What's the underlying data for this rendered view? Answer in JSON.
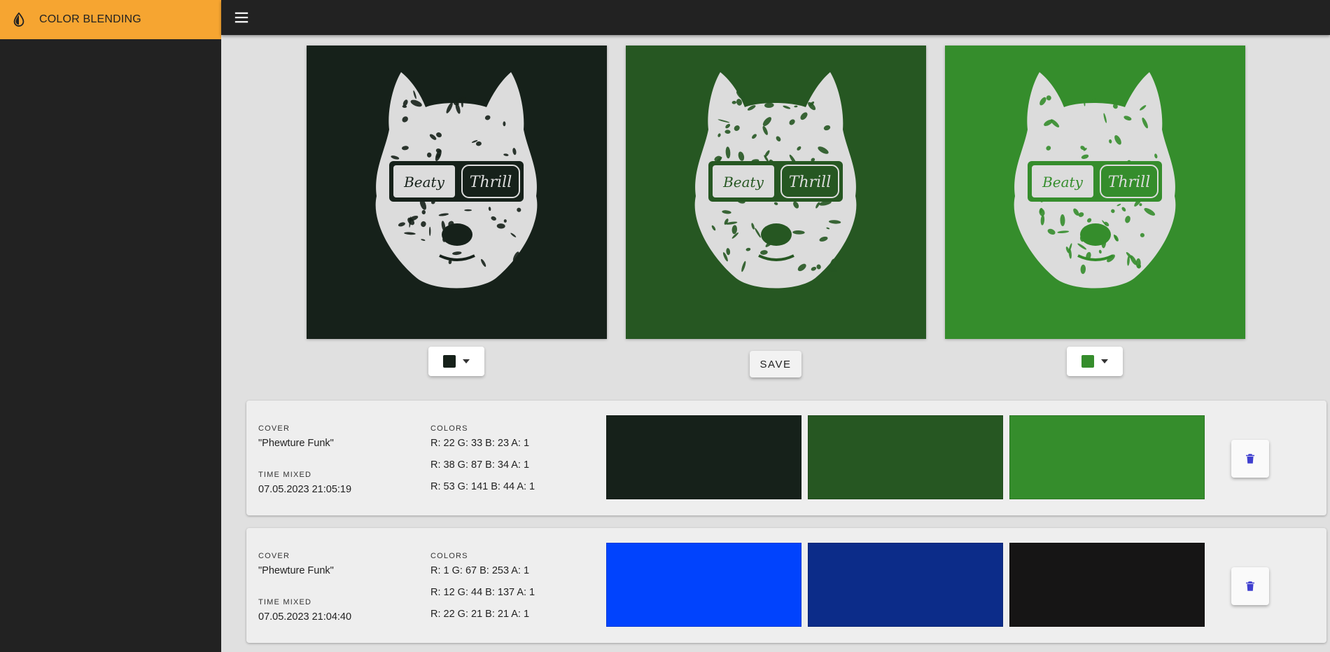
{
  "app": {
    "title": "COLOR BLENDING"
  },
  "covers": [
    {
      "name": "left",
      "color": "#16211a"
    },
    {
      "name": "middle",
      "color": "#265722"
    },
    {
      "name": "right",
      "color": "#358d2c"
    }
  ],
  "cover_text": {
    "left": "Beaty",
    "right": "Thrill"
  },
  "pickers": {
    "left_color": "#16211a",
    "right_color": "#358d2c"
  },
  "save_label": "SAVE",
  "history_labels": {
    "cover": "COVER",
    "time": "TIME MIXED",
    "colors": "COLORS"
  },
  "history": [
    {
      "cover": "\"Phewture Funk\"",
      "time": "07.05.2023 21:05:19",
      "colors": [
        {
          "text": "R: 22 G: 33 B: 23 A: 1",
          "hex": "#16211a"
        },
        {
          "text": "R: 38 G: 87 B: 34 A: 1",
          "hex": "#265722"
        },
        {
          "text": "R: 53 G: 141 B: 44 A: 1",
          "hex": "#358d2c"
        }
      ]
    },
    {
      "cover": "\"Phewture Funk\"",
      "time": "07.05.2023 21:04:40",
      "colors": [
        {
          "text": "R: 1 G: 67 B: 253 A: 1",
          "hex": "#0143fd"
        },
        {
          "text": "R: 12 G: 44 B: 137 A: 1",
          "hex": "#0c2c89"
        },
        {
          "text": "R: 22 G: 21 B: 21 A: 1",
          "hex": "#161515"
        }
      ]
    }
  ],
  "theme": {
    "accent": "#f6a531",
    "sidebar": "#222222",
    "icon_blue": "#3f3fcf"
  }
}
